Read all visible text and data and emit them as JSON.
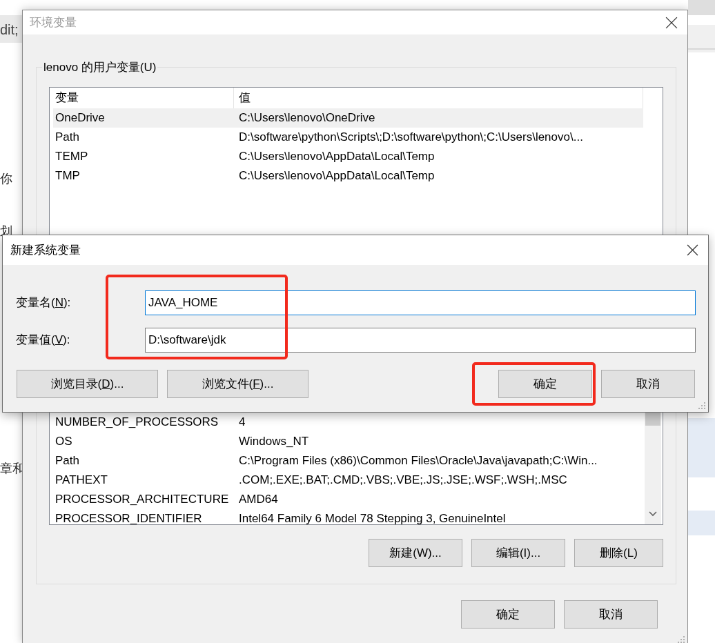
{
  "background_page": {
    "texts": [
      "dit;",
      "你",
      "划",
      "章和"
    ]
  },
  "environment_dialog": {
    "title": "环境变量",
    "active": false,
    "user_group": {
      "label": "lenovo 的用户变量(U)",
      "columns": [
        "变量",
        "值"
      ],
      "rows": [
        {
          "name": "OneDrive",
          "value": "C:\\Users\\lenovo\\OneDrive",
          "selected": true
        },
        {
          "name": "Path",
          "value": "D:\\software\\python\\Scripts\\;D:\\software\\python\\;C:\\Users\\lenovo\\...",
          "selected": false
        },
        {
          "name": "TEMP",
          "value": "C:\\Users\\lenovo\\AppData\\Local\\Temp",
          "selected": false
        },
        {
          "name": "TMP",
          "value": "C:\\Users\\lenovo\\AppData\\Local\\Temp",
          "selected": false
        }
      ]
    },
    "system_group": {
      "rows": [
        {
          "name": "NUMBER_OF_PROCESSORS",
          "value": "4",
          "selected": false
        },
        {
          "name": "OS",
          "value": "Windows_NT",
          "selected": false
        },
        {
          "name": "Path",
          "value": "C:\\Program Files (x86)\\Common Files\\Oracle\\Java\\javapath;C:\\Win...",
          "selected": false
        },
        {
          "name": "PATHEXT",
          "value": ".COM;.EXE;.BAT;.CMD;.VBS;.VBE;.JS;.JSE;.WSF;.WSH;.MSC",
          "selected": false
        },
        {
          "name": "PROCESSOR_ARCHITECTURE",
          "value": "AMD64",
          "selected": false
        },
        {
          "name": "PROCESSOR_IDENTIFIER",
          "value": "Intel64 Family 6 Model 78 Stepping 3, GenuineIntel",
          "selected": false
        }
      ],
      "buttons": [
        "新建(W)...",
        "编辑(I)...",
        "删除(L)"
      ]
    },
    "buttons": [
      "确定",
      "取消"
    ]
  },
  "new_variable_dialog": {
    "title": "新建系统变量",
    "fields": [
      {
        "label": "变量名(N):",
        "mnemonic_underlined": true,
        "value": "JAVA_HOME",
        "focused": true
      },
      {
        "label": "变量值(V):",
        "mnemonic_underlined": true,
        "value": "D:\\software\\jdk",
        "focused": false
      }
    ],
    "browse_buttons": [
      {
        "label": "浏览目录(D)...",
        "mnemonic_underlined": true
      },
      {
        "label": "浏览文件(F)...",
        "mnemonic_underlined": true
      }
    ],
    "fields_highlighted": true,
    "buttons": [
      {
        "label": "确定",
        "highlighted": true
      },
      {
        "label": "取消",
        "highlighted": false
      }
    ]
  }
}
